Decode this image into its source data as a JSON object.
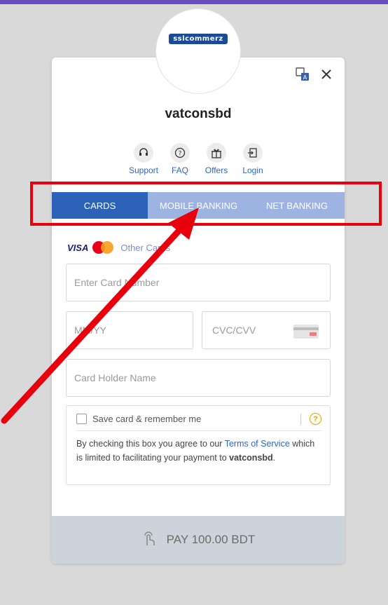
{
  "logo_text": "sslcommerz",
  "merchant": "vatconsbd",
  "quick_links": [
    {
      "label": "Support",
      "icon": "headset-icon"
    },
    {
      "label": "FAQ",
      "icon": "question-icon"
    },
    {
      "label": "Offers",
      "icon": "gift-icon"
    },
    {
      "label": "Login",
      "icon": "login-icon"
    }
  ],
  "tabs": [
    "CARDS",
    "MOBILE BANKING",
    "NET BANKING"
  ],
  "brands": {
    "visa": "VISA",
    "other": "Other Cards"
  },
  "fields": {
    "card_number": "Enter Card Number",
    "expiry": "MM/YY",
    "cvc": "CVC/CVV",
    "holder": "Card Holder Name"
  },
  "save": {
    "label": "Save card & remember me",
    "terms_prefix": "By checking this box you agree to our ",
    "terms_link": "Terms of Service",
    "terms_mid": " which is limited to facilitating your payment to ",
    "terms_merchant": "vatconsbd",
    "terms_end": "."
  },
  "pay_button": "PAY 100.00 BDT",
  "colors": {
    "accent": "#2c62b8",
    "tab_inactive": "#9db3e2",
    "annotation": "#e8000d"
  }
}
